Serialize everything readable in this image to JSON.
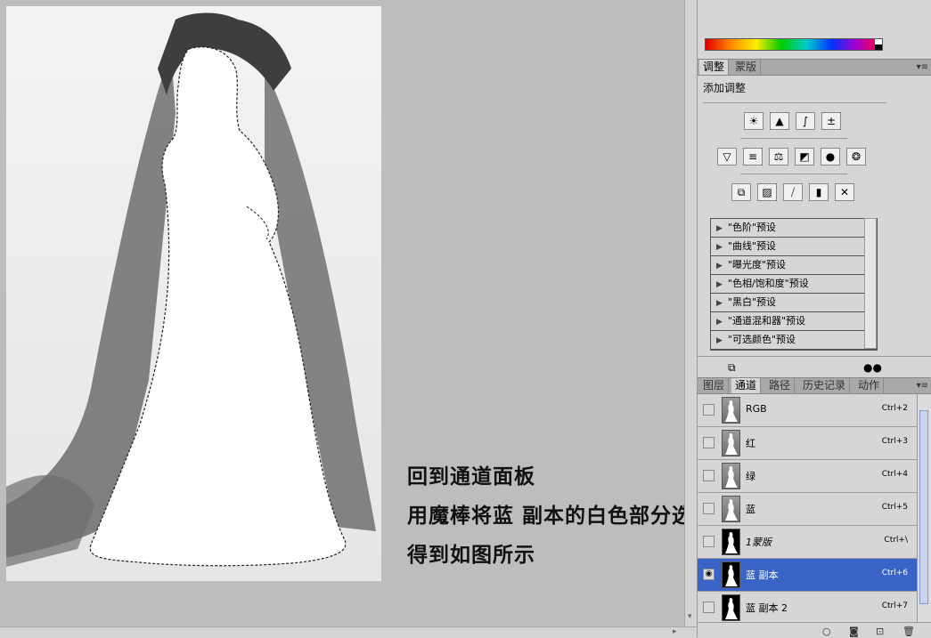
{
  "captions": {
    "line1": "回到通道面板",
    "line2": "用魔棒将蓝 副本的白色部分选中",
    "line3": "得到如图所示"
  },
  "adjustments": {
    "tabs": [
      "调整",
      "蒙版"
    ],
    "menu_icon": "▾≡",
    "title": "添加调整",
    "icon_rows": [
      [
        {
          "name": "brightness-contrast-icon",
          "glyph": "☀"
        },
        {
          "name": "levels-icon",
          "glyph": "▲"
        },
        {
          "name": "curves-icon",
          "glyph": "∫"
        },
        {
          "name": "exposure-icon",
          "glyph": "±"
        }
      ],
      [
        {
          "name": "vibrance-icon",
          "glyph": "▽"
        },
        {
          "name": "hue-saturation-icon",
          "glyph": "≡"
        },
        {
          "name": "color-balance-icon",
          "glyph": "⚖"
        },
        {
          "name": "black-white-icon",
          "glyph": "◩"
        },
        {
          "name": "photo-filter-icon",
          "glyph": "●"
        },
        {
          "name": "channel-mixer-icon",
          "glyph": "❂"
        }
      ],
      [
        {
          "name": "invert-icon",
          "glyph": "⧉"
        },
        {
          "name": "posterize-icon",
          "glyph": "▨"
        },
        {
          "name": "threshold-icon",
          "glyph": "⧸"
        },
        {
          "name": "gradient-map-icon",
          "glyph": "▮"
        },
        {
          "name": "selective-color-icon",
          "glyph": "✕"
        }
      ]
    ],
    "presets": [
      "\"色阶\"预设",
      "\"曲线\"预设",
      "\"曝光度\"预设",
      "\"色相/饱和度\"预设",
      "\"黑白\"预设",
      "\"通道混和器\"预设",
      "\"可选颜色\"预设"
    ],
    "footer_left_icon": "⧉",
    "footer_right_icon": "●●"
  },
  "channels_panel": {
    "tabs": [
      "图层",
      "通道",
      "路径",
      "历史记录",
      "动作"
    ],
    "active_tab": "通道",
    "menu_icon": "▾≡",
    "rows": [
      {
        "name": "RGB",
        "shortcut": "Ctrl+2",
        "thumb": "gray",
        "eye": false,
        "selected": false,
        "italic": false
      },
      {
        "name": "红",
        "shortcut": "Ctrl+3",
        "thumb": "gray",
        "eye": false,
        "selected": false,
        "italic": false
      },
      {
        "name": "绿",
        "shortcut": "Ctrl+4",
        "thumb": "gray",
        "eye": false,
        "selected": false,
        "italic": false
      },
      {
        "name": "蓝",
        "shortcut": "Ctrl+5",
        "thumb": "gray",
        "eye": false,
        "selected": false,
        "italic": false
      },
      {
        "name": "1蒙版",
        "shortcut": "Ctrl+\\",
        "thumb": "black",
        "eye": false,
        "selected": false,
        "italic": true
      },
      {
        "name": "蓝 副本",
        "shortcut": "Ctrl+6",
        "thumb": "black",
        "eye": true,
        "selected": true,
        "italic": false
      },
      {
        "name": "蓝 副本 2",
        "shortcut": "Ctrl+7",
        "thumb": "black",
        "eye": false,
        "selected": false,
        "italic": false
      }
    ],
    "footer_icons": [
      "○",
      "◙",
      "⊡",
      "🗑"
    ]
  },
  "scroll_arrows": {
    "down": "▾",
    "right": "▸"
  },
  "colors": {
    "selection_blue": "#3a63c8",
    "panel_bg": "#d6d6d6",
    "canvas_bg": "#bdbdbd"
  }
}
